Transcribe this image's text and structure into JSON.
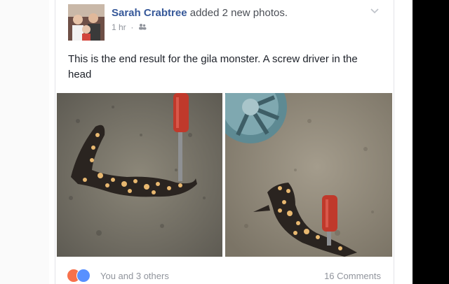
{
  "post": {
    "author": "Sarah Crabtree",
    "action": "added 2 new photos.",
    "time": "1 hr",
    "audience_icon": "friends-icon",
    "text": "This is the end result for the gila monster. A screw driver in the head"
  },
  "footer": {
    "reaction_icons": [
      "angry-reaction-icon",
      "like-reaction-icon"
    ],
    "reactions_text": "You and 3 others",
    "comments": "16 Comments"
  },
  "colors": {
    "author": "#365899",
    "meta": "#90949c",
    "screwdriver_handle": "#c0392b"
  }
}
